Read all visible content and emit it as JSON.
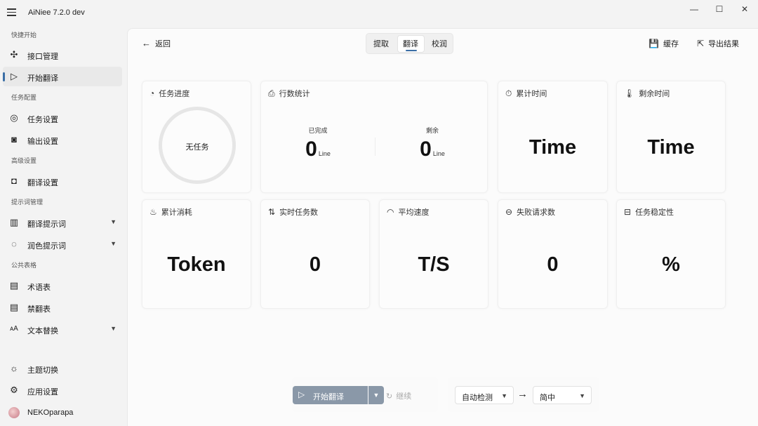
{
  "app": {
    "title": "AiNiee 7.2.0 dev",
    "window_controls": [
      "—",
      "☐",
      "✕"
    ]
  },
  "sidebar": {
    "sections": [
      {
        "title": "快捷开始",
        "items": [
          {
            "label": "接口管理",
            "icon": "api-hub-icon",
            "glyph": "✣"
          },
          {
            "label": "开始翻译",
            "icon": "play-icon",
            "glyph": "▷",
            "active": true
          }
        ]
      },
      {
        "title": "任务配置",
        "items": [
          {
            "label": "任务设置",
            "icon": "task-settings-icon",
            "glyph": "◎"
          },
          {
            "label": "输出设置",
            "icon": "output-settings-icon",
            "glyph": "◙"
          }
        ]
      },
      {
        "title": "高级设置",
        "items": [
          {
            "label": "翻译设置",
            "icon": "translate-settings-icon",
            "glyph": "◘"
          }
        ]
      },
      {
        "title": "提示词管理",
        "items": [
          {
            "label": "翻译提示词",
            "icon": "library-icon",
            "glyph": "▥",
            "expandable": true
          },
          {
            "label": "润色提示词",
            "icon": "polish-icon",
            "glyph": "◌",
            "expandable": true
          }
        ]
      },
      {
        "title": "公共表格",
        "items": [
          {
            "label": "术语表",
            "icon": "glossary-icon",
            "glyph": "▤"
          },
          {
            "label": "禁翻表",
            "icon": "no-translate-icon",
            "glyph": "▤"
          },
          {
            "label": "文本替换",
            "icon": "text-replace-icon",
            "glyph": "ᴀA",
            "expandable": true
          }
        ]
      }
    ],
    "footer": [
      {
        "label": "主题切换",
        "icon": "theme-icon",
        "glyph": "☼"
      },
      {
        "label": "应用设置",
        "icon": "gear-icon",
        "glyph": "⚙"
      },
      {
        "label": "NEKOparapa",
        "icon": "avatar",
        "glyph": ""
      }
    ]
  },
  "header": {
    "back_label": "返回",
    "tabs": [
      "提取",
      "翻译",
      "校润"
    ],
    "active_tab": "翻译",
    "save_label": "缓存",
    "export_label": "导出结果"
  },
  "cards": {
    "progress": {
      "title": "任务进度",
      "ring_label": "无任务"
    },
    "lines": {
      "title": "行数统计",
      "done_label": "已完成",
      "done_value": "0",
      "remain_label": "剩余",
      "remain_value": "0",
      "unit": "Line"
    },
    "elapsed": {
      "title": "累计时间",
      "value": "Time"
    },
    "remaining": {
      "title": "剩余时间",
      "value": "Time"
    },
    "tokens": {
      "title": "累计消耗",
      "value": "Token"
    },
    "realtime_tasks": {
      "title": "实时任务数",
      "value": "0"
    },
    "avg_speed": {
      "title": "平均速度",
      "value": "T/S"
    },
    "failed": {
      "title": "失败请求数",
      "value": "0"
    },
    "stability": {
      "title": "任务稳定性",
      "value": "%"
    }
  },
  "bottom": {
    "start_label": "开始翻译",
    "continue_label": "继续",
    "source_lang": "自动检测",
    "target_lang": "简中"
  },
  "colors": {
    "accent": "#3a6ea5",
    "start_button": "#8a98a8"
  }
}
